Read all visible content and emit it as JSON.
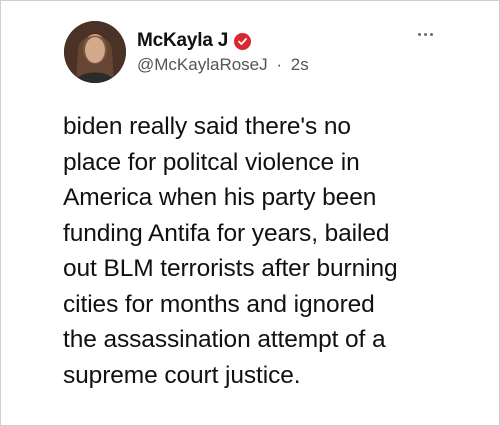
{
  "tweet": {
    "author": {
      "display_name": "McKayla J",
      "verified_badge_icon": "verified-badge-icon",
      "handle": "@McKaylaRoseJ",
      "separator": "·",
      "timestamp": "2s",
      "avatar_icon": "user-avatar"
    },
    "more_icon": "more-options-icon",
    "text": "biden really said there's no\nplace for politcal violence in\nAmerica when his party been\nfunding Antifa for years, bailed\nout BLM terrorists after burning\ncities for months and ignored\nthe assassination attempt of a\nsupreme court justice."
  },
  "colors": {
    "badge": "#d9282f",
    "text": "#111111",
    "muted": "#555555"
  }
}
